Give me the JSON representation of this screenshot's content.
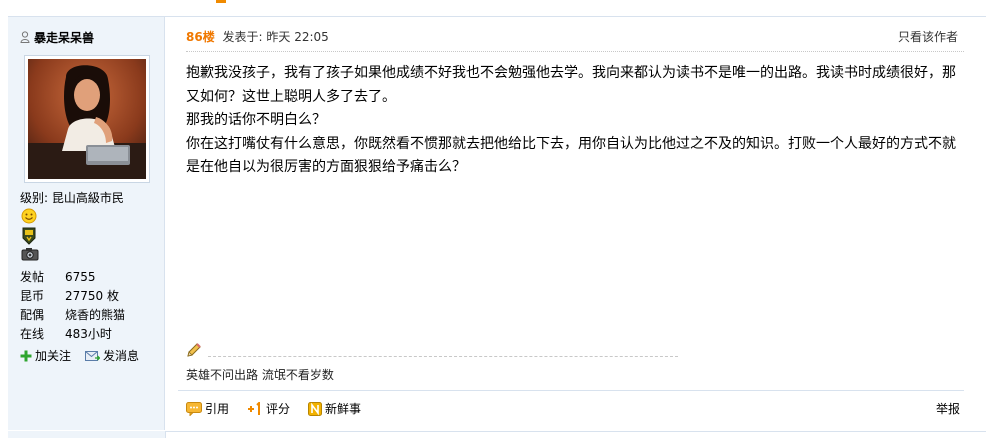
{
  "user": {
    "name": "暴走呆呆兽",
    "level_label": "级别:",
    "level": "昆山高級市民"
  },
  "stats": [
    {
      "label": "发帖",
      "value": "6755"
    },
    {
      "label": "昆币",
      "value": "27750 枚"
    },
    {
      "label": "配偶",
      "value": "烧香的熊猫"
    },
    {
      "label": "在线",
      "value": "483小时"
    }
  ],
  "user_actions": {
    "follow": "加关注",
    "message": "发消息"
  },
  "post": {
    "floor": "86楼",
    "posted_at": "发表于: 昨天 22:05",
    "only_author": "只看该作者",
    "lines": [
      "抱歉我没孩子，我有了孩子如果他成绩不好我也不会勉强他去学。我向来都认为读书不是唯一的出路。我读书时成绩很好，那",
      "又如何？这世上聪明人多了去了。",
      "那我的话你不明白么？",
      "你在这打嘴仗有什么意思，你既然看不惯那就去把他给比下去，用你自认为比他过之不及的知识。打败一个人最好的方式不就",
      "是在他自以为很厉害的方面狠狠给予痛击么？"
    ],
    "signature": "英雄不问出路 流氓不看岁数"
  },
  "footer": {
    "quote": "引用",
    "rate": "评分",
    "news": "新鲜事",
    "report": "举报"
  },
  "colors": {
    "sidebar_bg": "#eef4fa",
    "floor_color": "#f07800",
    "border": "#d8e2ee"
  }
}
